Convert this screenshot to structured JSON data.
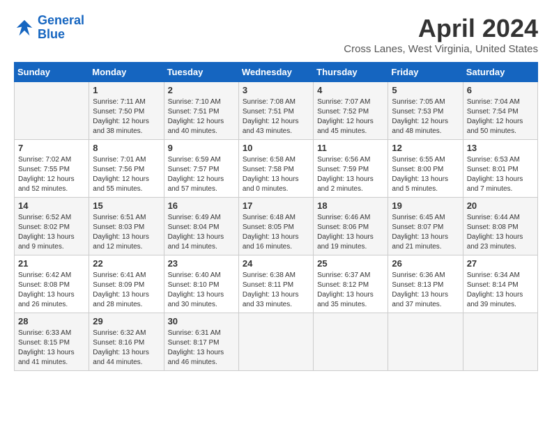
{
  "logo": {
    "line1": "General",
    "line2": "Blue"
  },
  "title": "April 2024",
  "subtitle": "Cross Lanes, West Virginia, United States",
  "headers": [
    "Sunday",
    "Monday",
    "Tuesday",
    "Wednesday",
    "Thursday",
    "Friday",
    "Saturday"
  ],
  "weeks": [
    [
      {
        "day": "",
        "info": ""
      },
      {
        "day": "1",
        "info": "Sunrise: 7:11 AM\nSunset: 7:50 PM\nDaylight: 12 hours\nand 38 minutes."
      },
      {
        "day": "2",
        "info": "Sunrise: 7:10 AM\nSunset: 7:51 PM\nDaylight: 12 hours\nand 40 minutes."
      },
      {
        "day": "3",
        "info": "Sunrise: 7:08 AM\nSunset: 7:51 PM\nDaylight: 12 hours\nand 43 minutes."
      },
      {
        "day": "4",
        "info": "Sunrise: 7:07 AM\nSunset: 7:52 PM\nDaylight: 12 hours\nand 45 minutes."
      },
      {
        "day": "5",
        "info": "Sunrise: 7:05 AM\nSunset: 7:53 PM\nDaylight: 12 hours\nand 48 minutes."
      },
      {
        "day": "6",
        "info": "Sunrise: 7:04 AM\nSunset: 7:54 PM\nDaylight: 12 hours\nand 50 minutes."
      }
    ],
    [
      {
        "day": "7",
        "info": "Sunrise: 7:02 AM\nSunset: 7:55 PM\nDaylight: 12 hours\nand 52 minutes."
      },
      {
        "day": "8",
        "info": "Sunrise: 7:01 AM\nSunset: 7:56 PM\nDaylight: 12 hours\nand 55 minutes."
      },
      {
        "day": "9",
        "info": "Sunrise: 6:59 AM\nSunset: 7:57 PM\nDaylight: 12 hours\nand 57 minutes."
      },
      {
        "day": "10",
        "info": "Sunrise: 6:58 AM\nSunset: 7:58 PM\nDaylight: 13 hours\nand 0 minutes."
      },
      {
        "day": "11",
        "info": "Sunrise: 6:56 AM\nSunset: 7:59 PM\nDaylight: 13 hours\nand 2 minutes."
      },
      {
        "day": "12",
        "info": "Sunrise: 6:55 AM\nSunset: 8:00 PM\nDaylight: 13 hours\nand 5 minutes."
      },
      {
        "day": "13",
        "info": "Sunrise: 6:53 AM\nSunset: 8:01 PM\nDaylight: 13 hours\nand 7 minutes."
      }
    ],
    [
      {
        "day": "14",
        "info": "Sunrise: 6:52 AM\nSunset: 8:02 PM\nDaylight: 13 hours\nand 9 minutes."
      },
      {
        "day": "15",
        "info": "Sunrise: 6:51 AM\nSunset: 8:03 PM\nDaylight: 13 hours\nand 12 minutes."
      },
      {
        "day": "16",
        "info": "Sunrise: 6:49 AM\nSunset: 8:04 PM\nDaylight: 13 hours\nand 14 minutes."
      },
      {
        "day": "17",
        "info": "Sunrise: 6:48 AM\nSunset: 8:05 PM\nDaylight: 13 hours\nand 16 minutes."
      },
      {
        "day": "18",
        "info": "Sunrise: 6:46 AM\nSunset: 8:06 PM\nDaylight: 13 hours\nand 19 minutes."
      },
      {
        "day": "19",
        "info": "Sunrise: 6:45 AM\nSunset: 8:07 PM\nDaylight: 13 hours\nand 21 minutes."
      },
      {
        "day": "20",
        "info": "Sunrise: 6:44 AM\nSunset: 8:08 PM\nDaylight: 13 hours\nand 23 minutes."
      }
    ],
    [
      {
        "day": "21",
        "info": "Sunrise: 6:42 AM\nSunset: 8:08 PM\nDaylight: 13 hours\nand 26 minutes."
      },
      {
        "day": "22",
        "info": "Sunrise: 6:41 AM\nSunset: 8:09 PM\nDaylight: 13 hours\nand 28 minutes."
      },
      {
        "day": "23",
        "info": "Sunrise: 6:40 AM\nSunset: 8:10 PM\nDaylight: 13 hours\nand 30 minutes."
      },
      {
        "day": "24",
        "info": "Sunrise: 6:38 AM\nSunset: 8:11 PM\nDaylight: 13 hours\nand 33 minutes."
      },
      {
        "day": "25",
        "info": "Sunrise: 6:37 AM\nSunset: 8:12 PM\nDaylight: 13 hours\nand 35 minutes."
      },
      {
        "day": "26",
        "info": "Sunrise: 6:36 AM\nSunset: 8:13 PM\nDaylight: 13 hours\nand 37 minutes."
      },
      {
        "day": "27",
        "info": "Sunrise: 6:34 AM\nSunset: 8:14 PM\nDaylight: 13 hours\nand 39 minutes."
      }
    ],
    [
      {
        "day": "28",
        "info": "Sunrise: 6:33 AM\nSunset: 8:15 PM\nDaylight: 13 hours\nand 41 minutes."
      },
      {
        "day": "29",
        "info": "Sunrise: 6:32 AM\nSunset: 8:16 PM\nDaylight: 13 hours\nand 44 minutes."
      },
      {
        "day": "30",
        "info": "Sunrise: 6:31 AM\nSunset: 8:17 PM\nDaylight: 13 hours\nand 46 minutes."
      },
      {
        "day": "",
        "info": ""
      },
      {
        "day": "",
        "info": ""
      },
      {
        "day": "",
        "info": ""
      },
      {
        "day": "",
        "info": ""
      }
    ]
  ]
}
